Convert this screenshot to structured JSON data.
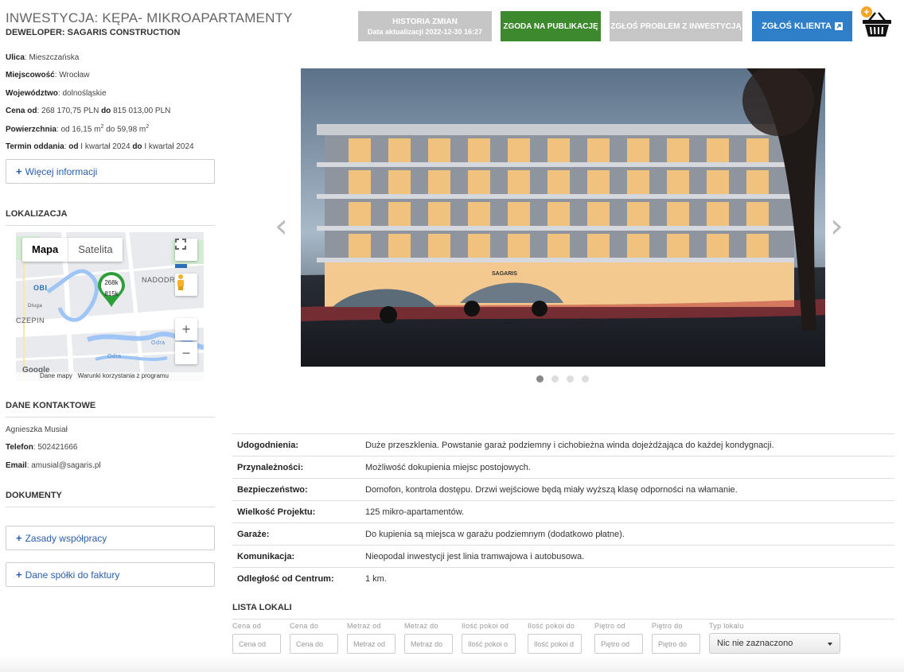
{
  "header": {
    "title": "INWESTYCJA: KĘPA- MIKROAPARTAMENTY",
    "developer": "DEWELOPER: SAGARIS CONSTRUCTION"
  },
  "info": {
    "ulica_label": "Ulica",
    "ulica": "Mieszczańska",
    "miejscowosc_label": "Miejscowość",
    "miejscowosc": "Wrocław",
    "wojewodztwo_label": "Województwo",
    "wojewodztwo": "dolnośląskie",
    "cena_label": "Cena od",
    "cena_od": "268 170,75 PLN",
    "do_word": "do",
    "cena_do": "815 013,00 PLN",
    "powierzchnia_label": "Powierzchnia",
    "pow_od": "od 16,15 m",
    "pow_do": "59,98 m",
    "sq": "2",
    "termin_label": "Termin oddania",
    "od_word": "od",
    "termin_od": "I kwartał 2024",
    "termin_do": "I kwartał 2024"
  },
  "more_info": "Więcej informacji",
  "plus": "+",
  "lokalizacja": "LOKALIZACJA",
  "map": {
    "tab_map": "Mapa",
    "tab_sat": "Satelita",
    "marker_top": "268k",
    "marker_bottom": "815k",
    "label_nadodrze": "NADODR",
    "label_szczepin": "CZEPIN",
    "label_obi": "OBI",
    "label_odra1": "Odra",
    "label_odra2": "Odra",
    "label_dluga": "Długa",
    "zoom_in": "+",
    "zoom_out": "−",
    "footer_data": "Dane mapy",
    "footer_terms": "Warunki korzystania z programu",
    "google": "Google"
  },
  "contact": {
    "heading": "DANE KONTAKTOWE",
    "name": "Agnieszka Musiał",
    "phone_label": "Telefon",
    "phone": "502421666",
    "email_label": "Email",
    "email": "amusial@sagaris.pl"
  },
  "documents": {
    "heading": "DOKUMENTY",
    "zasady": "Zasady współpracy",
    "dane_spolki": "Dane spółki do faktury"
  },
  "top_buttons": {
    "historia": "HISTORIA ZMIAN",
    "historia_sub": "Data aktualizacji 2022-12-30 16:27",
    "zgoda": "ZGODA NA PUBLIKACJĘ",
    "zglos_problem": "ZGŁOŚ PROBLEM Z INWESTYCJĄ",
    "zglos_klienta": "ZGŁOŚ KLIENTA",
    "cart_badge": "+"
  },
  "gallery": {
    "sign": "SAGARIS",
    "prev": "‹",
    "next": "›",
    "slides": 4,
    "active_slide": 1
  },
  "details": [
    {
      "label": "Udogodnienia:",
      "value": "Duże przeszklenia. Powstanie garaż podziemny i cichobieżna winda dojeżdżająca do każdej kondygnacji."
    },
    {
      "label": "Przynależności:",
      "value": "Możliwość dokupienia miejsc postojowych."
    },
    {
      "label": "Bezpieczeństwo:",
      "value": "Domofon, kontrola dostępu. Drzwi wejściowe będą miały wyższą klasę odporności na włamanie."
    },
    {
      "label": "Wielkość Projektu:",
      "value": "125 mikro-apartamentów."
    },
    {
      "label": "Garaże:",
      "value": "Do kupienia są miejsca w garażu podziemnym (dodatkowo płatne)."
    },
    {
      "label": "Komunikacja:",
      "value": "Nieopodal inwestycji jest linia tramwajowa i autobusowa."
    },
    {
      "label": "Odległość od Centrum:",
      "value": "1 km."
    }
  ],
  "lista": {
    "heading": "LISTA LOKALI",
    "filters": [
      {
        "label": "Cena od",
        "placeholder": "Cena od"
      },
      {
        "label": "Cena do",
        "placeholder": "Cena do"
      },
      {
        "label": "Metraż od",
        "placeholder": "Metraż od"
      },
      {
        "label": "Metraż do",
        "placeholder": "Metraż do"
      },
      {
        "label": "Ilość pokoi od",
        "placeholder": "Ilość pokoi o"
      },
      {
        "label": "Ilość pokoi do",
        "placeholder": "Ilość pokoi d"
      },
      {
        "label": "Piętro od",
        "placeholder": "Piętro od"
      },
      {
        "label": "Piętro do",
        "placeholder": "Piętro do"
      }
    ],
    "typ_label": "Typ lokalu",
    "typ_value": "Nic nie zaznaczono"
  }
}
